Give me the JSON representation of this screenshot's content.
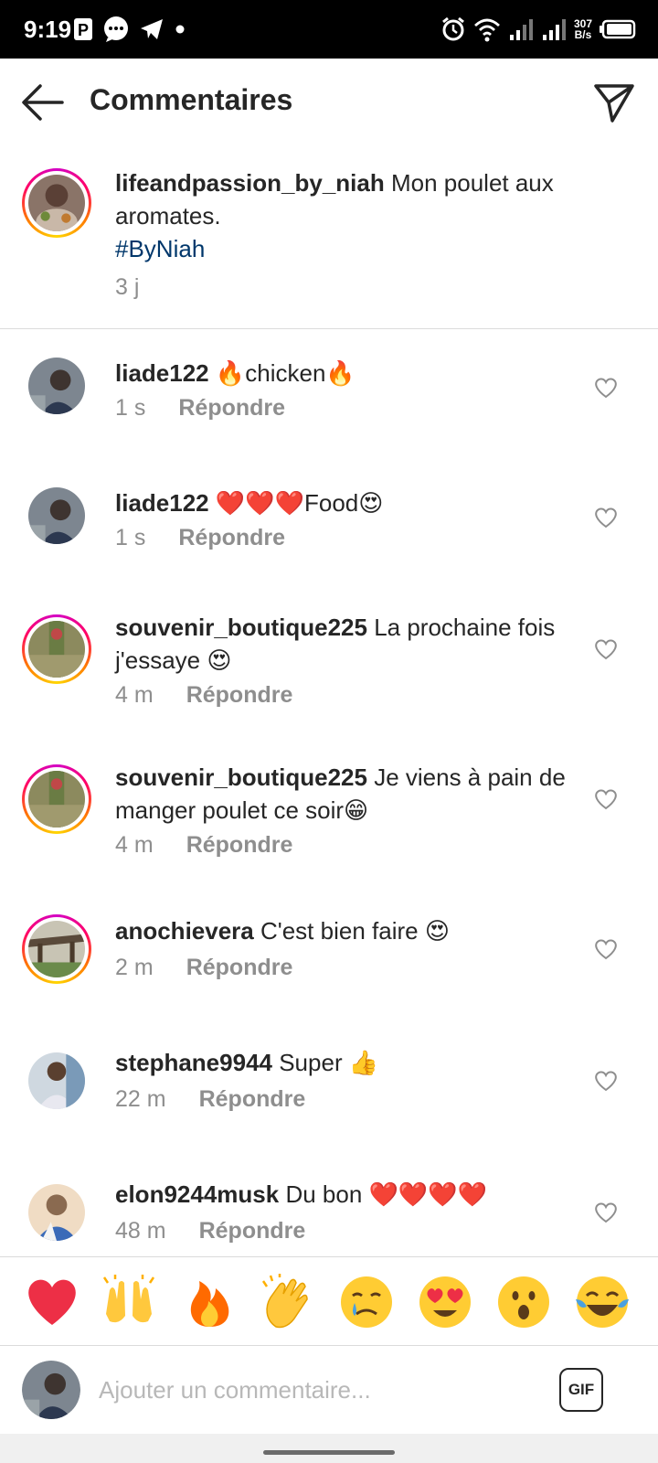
{
  "status_bar": {
    "time": "9:19",
    "left_icons": [
      "p-icon",
      "chat-bubble-icon",
      "telegram-icon",
      "dot-icon"
    ],
    "right_icons": [
      "alarm-icon",
      "wifi-icon",
      "signal-1-icon",
      "signal-2-icon",
      "battery-icon"
    ],
    "speed_value": "307",
    "speed_unit": "B/s"
  },
  "header": {
    "title": "Commentaires"
  },
  "caption": {
    "username": "lifeandpassion_by_niah",
    "text": "Mon poulet aux aromates.",
    "hashtag": "#ByNiah",
    "time": "3 j"
  },
  "comments": [
    {
      "username": "liade122",
      "text": "🔥chicken🔥",
      "time": "1 s",
      "reply": "Répondre"
    },
    {
      "username": "liade122",
      "text": "❤️❤️❤️Food😍",
      "time": "1 s",
      "reply": "Répondre"
    },
    {
      "username": "souvenir_boutique225",
      "text": "La prochaine fois j'essaye 😍",
      "time": "4 m",
      "reply": "Répondre"
    },
    {
      "username": "souvenir_boutique225",
      "text": "Je viens à pain de manger poulet ce soir😁",
      "time": "4 m",
      "reply": "Répondre"
    },
    {
      "username": "anochievera",
      "text": "C'est bien faire 😍",
      "time": "2 m",
      "reply": "Répondre"
    },
    {
      "username": "stephane9944",
      "text": "Super 👍",
      "time": "22 m",
      "reply": "Répondre"
    },
    {
      "username": "elon9244musk",
      "text": "Du bon ❤️❤️❤️❤️",
      "time": "48 m",
      "reply": "Répondre"
    }
  ],
  "reactions": [
    "❤️",
    "🙌",
    "🔥",
    "👏",
    "😢",
    "😍",
    "😮",
    "😂"
  ],
  "input": {
    "placeholder": "Ajouter un commentaire...",
    "gif_label": "GIF"
  },
  "colors": {
    "text": "#262626",
    "secondary": "#8e8e8e",
    "hashtag": "#00376b",
    "heart_red": "#ed2f46",
    "flame_orange": "#ff6a00",
    "emoji_yellow": "#ffcc33"
  }
}
